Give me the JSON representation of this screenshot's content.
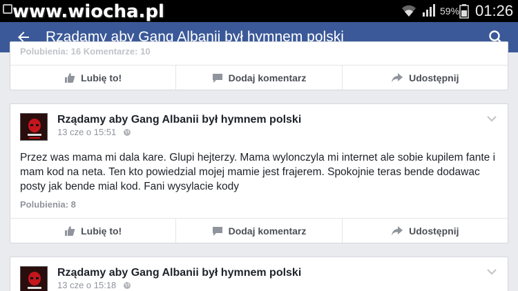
{
  "statusbar": {
    "watermark": "www.wiocha.pl",
    "battery_percent": "59%",
    "time": "01:26",
    "icons": [
      "wifi-icon",
      "signal-icon",
      "battery-icon"
    ]
  },
  "appbar": {
    "title": "Rządamy aby Gang Albanii był hymnem polski",
    "icons": [
      "back-arrow-icon",
      "search-icon"
    ],
    "color": "#3b5998"
  },
  "actions": {
    "like": "Lubię to!",
    "comment": "Dodaj komentarz",
    "share": "Udostępnij"
  },
  "top_card": {
    "stats": "Polubienia: 16   Komentarze: 10"
  },
  "posts": [
    {
      "author": "Rządamy aby Gang Albanii był hymnem polski",
      "time": "13 cze o 15:51",
      "body": "Przez was mama mi dala kare. Glupi hejterzy. Mama wylonczyla mi internet ale sobie kupilem fante i mam kod na neta. Ten kto powiedzial mojej mamie jest frajerem. Spokojnie teras bende dodawac posty jak bende mial kod. Fani wysylacie kody",
      "likes": "Polubienia: 8"
    },
    {
      "author": "Rządamy aby Gang Albanii był hymnem polski",
      "time": "13 cze o 15:18"
    }
  ]
}
